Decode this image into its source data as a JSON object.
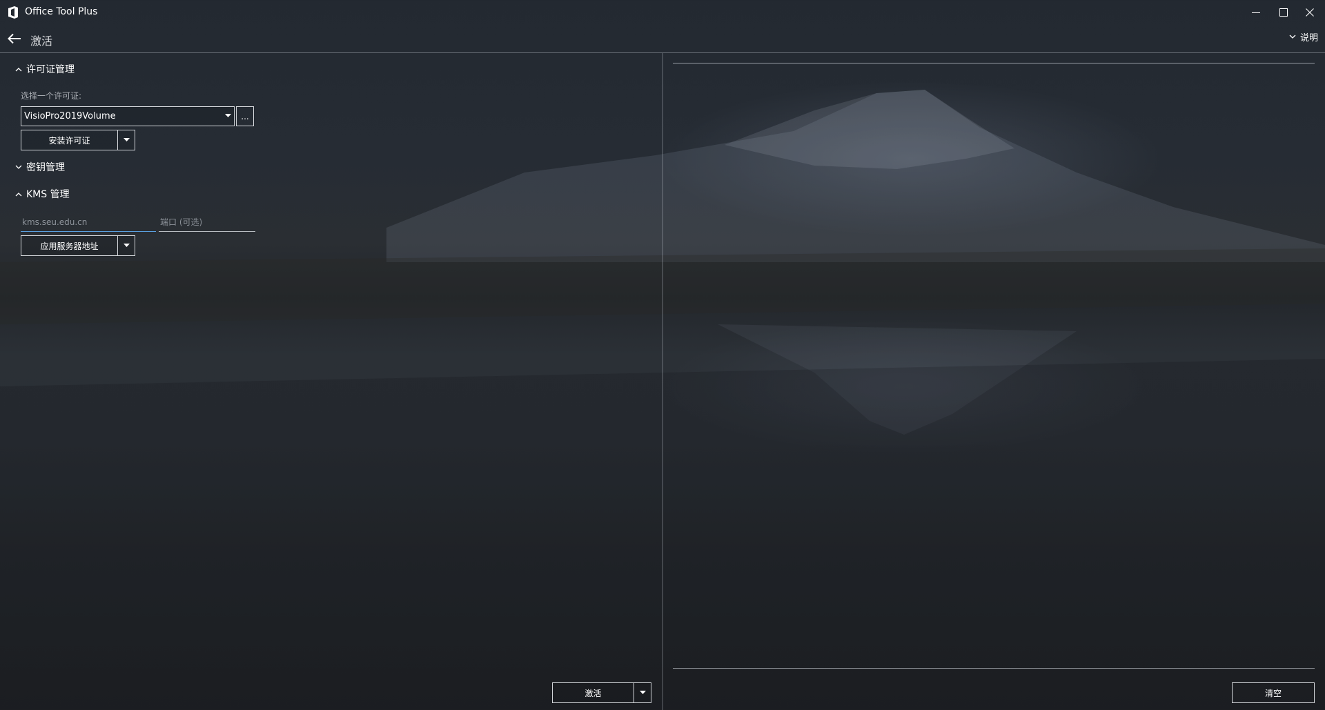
{
  "window": {
    "title": "Office Tool Plus"
  },
  "header": {
    "page_title": "激活",
    "help_label": "说明"
  },
  "license_section": {
    "title": "许可证管理",
    "select_label": "选择一个许可证:",
    "selected_license": "VisioPro2019Volume",
    "browse_label": "...",
    "install_button": "安装许可证"
  },
  "key_section": {
    "title": "密钥管理"
  },
  "kms_section": {
    "title": "KMS 管理",
    "server_value": "kms.seu.edu.cn",
    "port_placeholder": "端口 (可选)",
    "apply_button": "应用服务器地址"
  },
  "footer": {
    "activate_button": "激活",
    "clear_button": "清空"
  }
}
